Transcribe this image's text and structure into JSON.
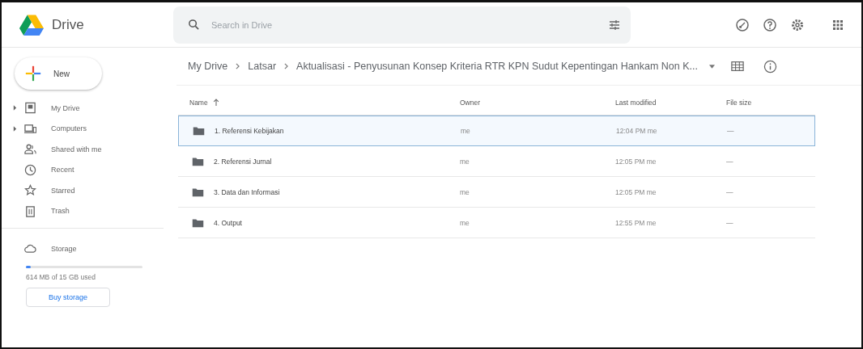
{
  "header": {
    "app_name": "Drive",
    "search": {
      "placeholder": "Search in Drive"
    }
  },
  "new_button": {
    "label": "New"
  },
  "sidebar": {
    "items": [
      {
        "label": "My Drive",
        "expandable": true
      },
      {
        "label": "Computers",
        "expandable": true
      },
      {
        "label": "Shared with me",
        "expandable": false
      },
      {
        "label": "Recent",
        "expandable": false
      },
      {
        "label": "Starred",
        "expandable": false
      },
      {
        "label": "Trash",
        "expandable": false
      }
    ],
    "storage": {
      "label": "Storage",
      "level": 0.04,
      "usage": "614 MB of 15 GB used",
      "button": "Buy storage"
    }
  },
  "breadcrumb": [
    "My Drive",
    "Latsar",
    "Aktualisasi - Penyusunan Konsep Kriteria RTR KPN Sudut Kepentingan Hankam Non K..."
  ],
  "table": {
    "columns": [
      "Name",
      "Owner",
      "Last modified",
      "File size"
    ],
    "rows": [
      {
        "name": "1. Referensi Kebijakan",
        "owner": "me",
        "modified": "12:04 PM me",
        "size": "—",
        "selected": true
      },
      {
        "name": "2. Referensi Jurnal",
        "owner": "me",
        "modified": "12:05 PM me",
        "size": "—",
        "selected": false
      },
      {
        "name": "3. Data dan Informasi",
        "owner": "me",
        "modified": "12:05 PM me",
        "size": "—",
        "selected": false
      },
      {
        "name": "4. Output",
        "owner": "me",
        "modified": "12:55 PM me",
        "size": "—",
        "selected": false
      }
    ]
  }
}
